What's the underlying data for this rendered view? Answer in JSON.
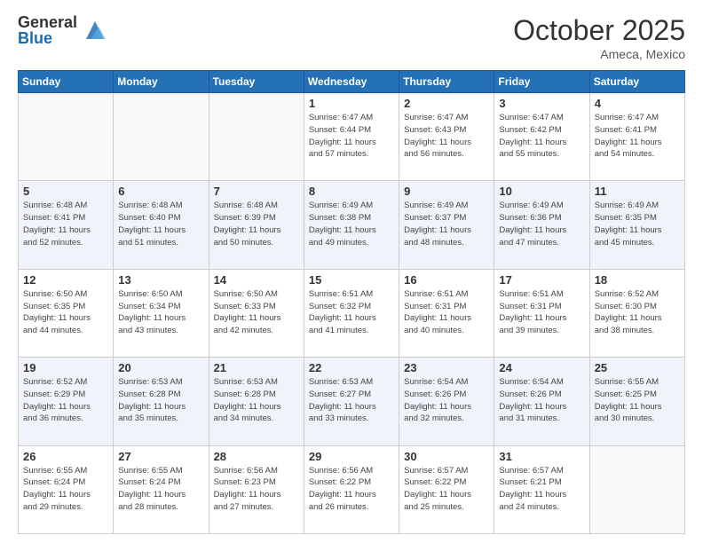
{
  "header": {
    "logo_general": "General",
    "logo_blue": "Blue",
    "month": "October 2025",
    "location": "Ameca, Mexico"
  },
  "days_of_week": [
    "Sunday",
    "Monday",
    "Tuesday",
    "Wednesday",
    "Thursday",
    "Friday",
    "Saturday"
  ],
  "weeks": [
    [
      {
        "day": "",
        "info": ""
      },
      {
        "day": "",
        "info": ""
      },
      {
        "day": "",
        "info": ""
      },
      {
        "day": "1",
        "info": "Sunrise: 6:47 AM\nSunset: 6:44 PM\nDaylight: 11 hours\nand 57 minutes."
      },
      {
        "day": "2",
        "info": "Sunrise: 6:47 AM\nSunset: 6:43 PM\nDaylight: 11 hours\nand 56 minutes."
      },
      {
        "day": "3",
        "info": "Sunrise: 6:47 AM\nSunset: 6:42 PM\nDaylight: 11 hours\nand 55 minutes."
      },
      {
        "day": "4",
        "info": "Sunrise: 6:47 AM\nSunset: 6:41 PM\nDaylight: 11 hours\nand 54 minutes."
      }
    ],
    [
      {
        "day": "5",
        "info": "Sunrise: 6:48 AM\nSunset: 6:41 PM\nDaylight: 11 hours\nand 52 minutes."
      },
      {
        "day": "6",
        "info": "Sunrise: 6:48 AM\nSunset: 6:40 PM\nDaylight: 11 hours\nand 51 minutes."
      },
      {
        "day": "7",
        "info": "Sunrise: 6:48 AM\nSunset: 6:39 PM\nDaylight: 11 hours\nand 50 minutes."
      },
      {
        "day": "8",
        "info": "Sunrise: 6:49 AM\nSunset: 6:38 PM\nDaylight: 11 hours\nand 49 minutes."
      },
      {
        "day": "9",
        "info": "Sunrise: 6:49 AM\nSunset: 6:37 PM\nDaylight: 11 hours\nand 48 minutes."
      },
      {
        "day": "10",
        "info": "Sunrise: 6:49 AM\nSunset: 6:36 PM\nDaylight: 11 hours\nand 47 minutes."
      },
      {
        "day": "11",
        "info": "Sunrise: 6:49 AM\nSunset: 6:35 PM\nDaylight: 11 hours\nand 45 minutes."
      }
    ],
    [
      {
        "day": "12",
        "info": "Sunrise: 6:50 AM\nSunset: 6:35 PM\nDaylight: 11 hours\nand 44 minutes."
      },
      {
        "day": "13",
        "info": "Sunrise: 6:50 AM\nSunset: 6:34 PM\nDaylight: 11 hours\nand 43 minutes."
      },
      {
        "day": "14",
        "info": "Sunrise: 6:50 AM\nSunset: 6:33 PM\nDaylight: 11 hours\nand 42 minutes."
      },
      {
        "day": "15",
        "info": "Sunrise: 6:51 AM\nSunset: 6:32 PM\nDaylight: 11 hours\nand 41 minutes."
      },
      {
        "day": "16",
        "info": "Sunrise: 6:51 AM\nSunset: 6:31 PM\nDaylight: 11 hours\nand 40 minutes."
      },
      {
        "day": "17",
        "info": "Sunrise: 6:51 AM\nSunset: 6:31 PM\nDaylight: 11 hours\nand 39 minutes."
      },
      {
        "day": "18",
        "info": "Sunrise: 6:52 AM\nSunset: 6:30 PM\nDaylight: 11 hours\nand 38 minutes."
      }
    ],
    [
      {
        "day": "19",
        "info": "Sunrise: 6:52 AM\nSunset: 6:29 PM\nDaylight: 11 hours\nand 36 minutes."
      },
      {
        "day": "20",
        "info": "Sunrise: 6:53 AM\nSunset: 6:28 PM\nDaylight: 11 hours\nand 35 minutes."
      },
      {
        "day": "21",
        "info": "Sunrise: 6:53 AM\nSunset: 6:28 PM\nDaylight: 11 hours\nand 34 minutes."
      },
      {
        "day": "22",
        "info": "Sunrise: 6:53 AM\nSunset: 6:27 PM\nDaylight: 11 hours\nand 33 minutes."
      },
      {
        "day": "23",
        "info": "Sunrise: 6:54 AM\nSunset: 6:26 PM\nDaylight: 11 hours\nand 32 minutes."
      },
      {
        "day": "24",
        "info": "Sunrise: 6:54 AM\nSunset: 6:26 PM\nDaylight: 11 hours\nand 31 minutes."
      },
      {
        "day": "25",
        "info": "Sunrise: 6:55 AM\nSunset: 6:25 PM\nDaylight: 11 hours\nand 30 minutes."
      }
    ],
    [
      {
        "day": "26",
        "info": "Sunrise: 6:55 AM\nSunset: 6:24 PM\nDaylight: 11 hours\nand 29 minutes."
      },
      {
        "day": "27",
        "info": "Sunrise: 6:55 AM\nSunset: 6:24 PM\nDaylight: 11 hours\nand 28 minutes."
      },
      {
        "day": "28",
        "info": "Sunrise: 6:56 AM\nSunset: 6:23 PM\nDaylight: 11 hours\nand 27 minutes."
      },
      {
        "day": "29",
        "info": "Sunrise: 6:56 AM\nSunset: 6:22 PM\nDaylight: 11 hours\nand 26 minutes."
      },
      {
        "day": "30",
        "info": "Sunrise: 6:57 AM\nSunset: 6:22 PM\nDaylight: 11 hours\nand 25 minutes."
      },
      {
        "day": "31",
        "info": "Sunrise: 6:57 AM\nSunset: 6:21 PM\nDaylight: 11 hours\nand 24 minutes."
      },
      {
        "day": "",
        "info": ""
      }
    ]
  ]
}
